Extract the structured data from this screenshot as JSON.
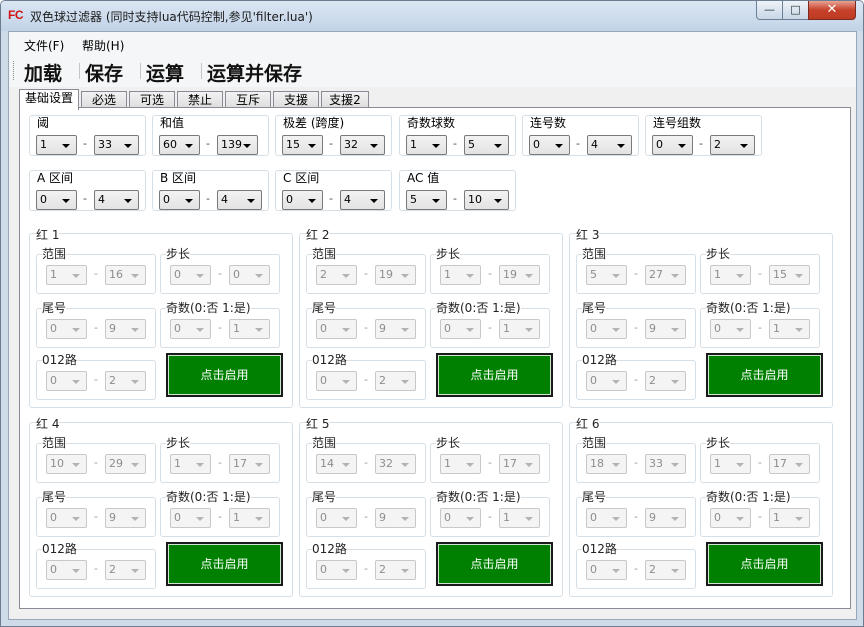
{
  "window": {
    "icon_text": "FC",
    "title": "双色球过滤器 (同时支持lua代码控制,参见'filter.lua')",
    "minimize": "—",
    "maximize": "□",
    "close": "✕"
  },
  "menu": [
    "文件(F)",
    "帮助(H)"
  ],
  "toolbar": [
    "加载",
    "保存",
    "运算",
    "运算并保存"
  ],
  "tabs": [
    "基础设置",
    "必选",
    "可选",
    "禁止",
    "互斥",
    "支援",
    "支援2"
  ],
  "active_tab": "基础设置",
  "basic": [
    {
      "label": "阈",
      "min": "1",
      "max": "33"
    },
    {
      "label": "和值",
      "min": "60",
      "max": "139"
    },
    {
      "label": "极差 (跨度)",
      "min": "15",
      "max": "32"
    },
    {
      "label": "奇数球数",
      "min": "1",
      "max": "5"
    },
    {
      "label": "连号数",
      "min": "0",
      "max": "4"
    },
    {
      "label": "连号组数",
      "min": "0",
      "max": "2"
    },
    {
      "label": "A 区间",
      "min": "0",
      "max": "4"
    },
    {
      "label": "B 区间",
      "min": "0",
      "max": "4"
    },
    {
      "label": "C 区间",
      "min": "0",
      "max": "4"
    },
    {
      "label": "AC 值",
      "min": "5",
      "max": "10"
    }
  ],
  "red_labels": {
    "range": "范围",
    "step": "步长",
    "tail": "尾号",
    "odd": "奇数(0:否  1:是)",
    "road": "012路",
    "enable_button": "点击启用"
  },
  "reds": [
    {
      "title": "红 1",
      "range": [
        "1",
        "16"
      ],
      "step": [
        "0",
        "0"
      ],
      "tail": [
        "0",
        "9"
      ],
      "odd": [
        "0",
        "1"
      ],
      "road": [
        "0",
        "2"
      ]
    },
    {
      "title": "红 2",
      "range": [
        "2",
        "19"
      ],
      "step": [
        "1",
        "19"
      ],
      "tail": [
        "0",
        "9"
      ],
      "odd": [
        "0",
        "1"
      ],
      "road": [
        "0",
        "2"
      ]
    },
    {
      "title": "红 3",
      "range": [
        "5",
        "27"
      ],
      "step": [
        "1",
        "15"
      ],
      "tail": [
        "0",
        "9"
      ],
      "odd": [
        "0",
        "1"
      ],
      "road": [
        "0",
        "2"
      ]
    },
    {
      "title": "红 4",
      "range": [
        "10",
        "29"
      ],
      "step": [
        "1",
        "17"
      ],
      "tail": [
        "0",
        "9"
      ],
      "odd": [
        "0",
        "1"
      ],
      "road": [
        "0",
        "2"
      ]
    },
    {
      "title": "红 5",
      "range": [
        "14",
        "32"
      ],
      "step": [
        "1",
        "17"
      ],
      "tail": [
        "0",
        "9"
      ],
      "odd": [
        "0",
        "1"
      ],
      "road": [
        "0",
        "2"
      ]
    },
    {
      "title": "红 6",
      "range": [
        "18",
        "33"
      ],
      "step": [
        "1",
        "17"
      ],
      "tail": [
        "0",
        "9"
      ],
      "odd": [
        "0",
        "1"
      ],
      "road": [
        "0",
        "2"
      ]
    }
  ],
  "colors": {
    "enable_button": "#008000",
    "icon_red": "#d01414"
  }
}
